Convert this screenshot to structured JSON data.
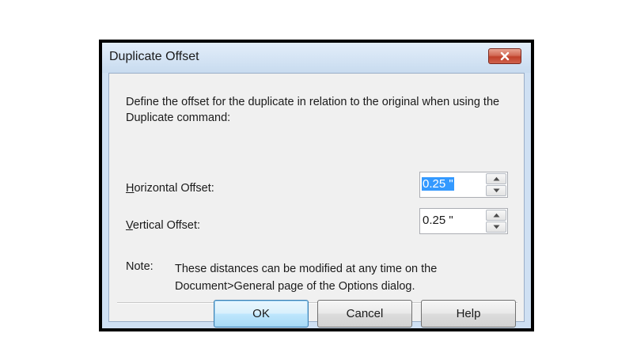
{
  "dialog": {
    "title": "Duplicate Offset",
    "description": "Define the offset for the duplicate in relation to the original when using the Duplicate command:"
  },
  "fields": {
    "horizontal": {
      "label_mnemonic": "H",
      "label_rest": "orizontal Offset:",
      "value": "0.25 \""
    },
    "vertical": {
      "label_mnemonic": "V",
      "label_rest": "ertical Offset:",
      "value": "0.25 \""
    }
  },
  "note": {
    "label": "Note:",
    "text": "These distances can be modified at any time on the Document>General page of the Options dialog."
  },
  "buttons": {
    "ok": "OK",
    "cancel": "Cancel",
    "help": "Help"
  },
  "icons": {
    "close": "close-icon",
    "spin_up": "arrow-up-icon",
    "spin_down": "arrow-down-icon"
  },
  "colors": {
    "title_bar": "#cfe0f3",
    "close_button": "#c0402a",
    "selection": "#3399ff",
    "default_button": "#bee6fd"
  }
}
